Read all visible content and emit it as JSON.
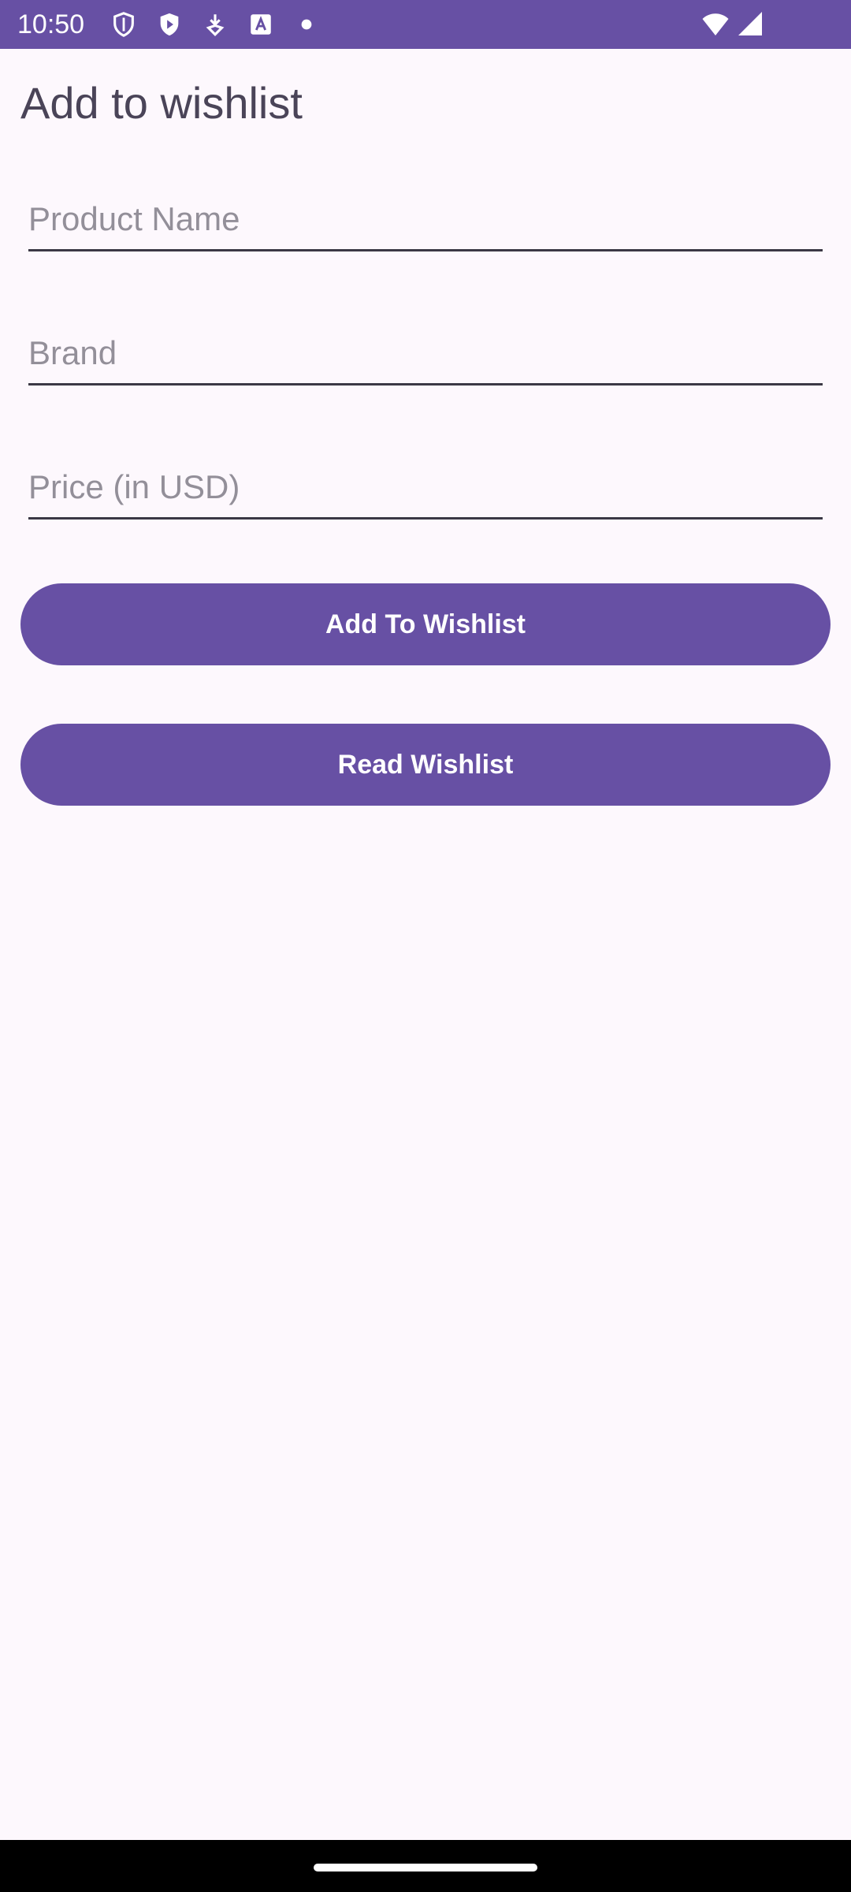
{
  "status_bar": {
    "time": "10:50",
    "background_color": "#6750a4",
    "icons": [
      "shield-outline-icon",
      "play-shield-icon",
      "download-icon",
      "text-a-icon",
      "dot-icon",
      "wifi-icon",
      "signal-icon"
    ]
  },
  "header": {
    "title": "Add to wishlist"
  },
  "form": {
    "product_name": {
      "value": "",
      "placeholder": "Product Name"
    },
    "brand": {
      "value": "",
      "placeholder": "Brand"
    },
    "price": {
      "value": "",
      "placeholder": "Price (in USD)"
    }
  },
  "actions": {
    "add_label": "Add To Wishlist",
    "read_label": "Read Wishlist"
  },
  "colors": {
    "primary": "#6750a4",
    "background": "#fdf8fd",
    "title_text": "#4a4458"
  }
}
